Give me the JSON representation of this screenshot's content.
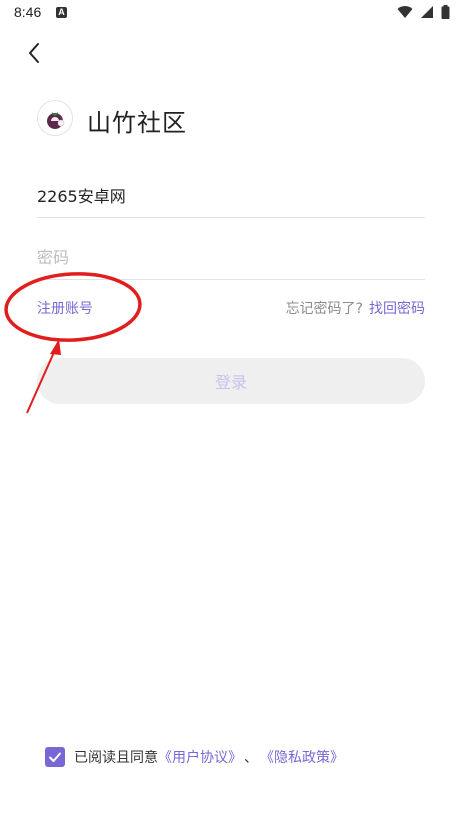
{
  "status_bar": {
    "time": "8:46",
    "notification_icon": "A"
  },
  "app": {
    "title": "山竹社区",
    "logo_icon": "mangosteen-logo-icon"
  },
  "form": {
    "username_value": "2265安卓网",
    "password_placeholder": "密码"
  },
  "links": {
    "register": "注册账号",
    "forgot_prompt": "忘记密码了?",
    "recover": "找回密码"
  },
  "login_button": "登录",
  "agreement": {
    "checked": true,
    "prefix": "已阅读且同意",
    "user_agreement": "《用户协议》",
    "separator": "、",
    "privacy_policy": "《隐私政策》"
  },
  "colors": {
    "accent": "#7a67d6",
    "annotation_red": "#e01e1e",
    "button_bg": "#efefef"
  }
}
